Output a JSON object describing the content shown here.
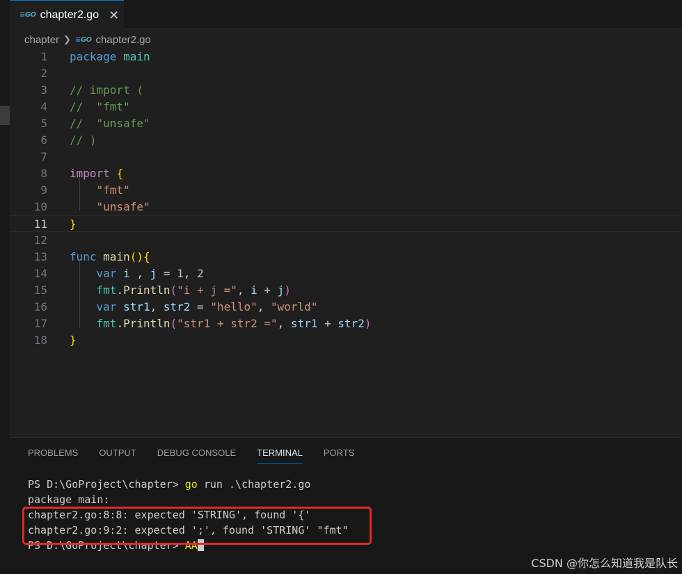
{
  "tab": {
    "icon": "go-file-icon",
    "label": "chapter2.go",
    "close": "✕"
  },
  "breadcrumb": {
    "folder": "chapter",
    "file": "chapter2.go"
  },
  "editor": {
    "current_line": 11,
    "lines": [
      "1",
      "2",
      "3",
      "4",
      "5",
      "6",
      "7",
      "8",
      "9",
      "10",
      "11",
      "12",
      "13",
      "14",
      "15",
      "16",
      "17",
      "18"
    ]
  },
  "panel": {
    "tabs": [
      "PROBLEMS",
      "OUTPUT",
      "DEBUG CONSOLE",
      "TERMINAL",
      "PORTS"
    ],
    "active_tab": "TERMINAL"
  },
  "terminal": {
    "prompt": "PS D:\\GoProject\\chapter> ",
    "command_go": "go",
    "command_rest": " run .\\chapter2.go",
    "out1": "package main:",
    "out2": "chapter2.go:8:8: expected 'STRING', found '{'",
    "out3": "chapter2.go:9:2: expected ';', found 'STRING' \"fmt\"",
    "input": "AA"
  },
  "watermark": "CSDN @你怎么知道我是队长"
}
